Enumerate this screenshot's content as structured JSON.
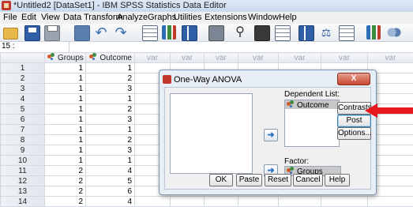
{
  "window": {
    "title": "*Untitled2 [DataSet1] - IBM SPSS Statistics Data Editor"
  },
  "menu": [
    "File",
    "Edit",
    "View",
    "Data",
    "Transform",
    "Analyze",
    "Graphs",
    "Utilities",
    "Extensions",
    "Window",
    "Help"
  ],
  "cell_ref": "15 :",
  "grid": {
    "headers": [
      "Groups",
      "Outcome",
      "var",
      "var",
      "var",
      "var",
      "var",
      "var",
      "var"
    ],
    "rows": [
      {
        "n": "1",
        "g": "1",
        "o": "1"
      },
      {
        "n": "2",
        "g": "1",
        "o": "2"
      },
      {
        "n": "3",
        "g": "1",
        "o": "3"
      },
      {
        "n": "4",
        "g": "1",
        "o": "1"
      },
      {
        "n": "5",
        "g": "1",
        "o": "2"
      },
      {
        "n": "6",
        "g": "1",
        "o": "3"
      },
      {
        "n": "7",
        "g": "1",
        "o": "1"
      },
      {
        "n": "8",
        "g": "1",
        "o": "2"
      },
      {
        "n": "9",
        "g": "1",
        "o": "3"
      },
      {
        "n": "10",
        "g": "1",
        "o": "1"
      },
      {
        "n": "11",
        "g": "2",
        "o": "4"
      },
      {
        "n": "12",
        "g": "2",
        "o": "5"
      },
      {
        "n": "13",
        "g": "2",
        "o": "6"
      },
      {
        "n": "14",
        "g": "2",
        "o": "4"
      }
    ]
  },
  "dialog": {
    "title": "One-Way ANOVA",
    "close": "X",
    "dependent_label": "Dependent List:",
    "dependent_items": [
      "Outcome"
    ],
    "factor_label": "Factor:",
    "factor_value": "Groups",
    "side_buttons": [
      "Contrasts...",
      "Post Hoc...",
      "Options..."
    ],
    "bottom_buttons": [
      "OK",
      "Paste",
      "Reset",
      "Cancel",
      "Help"
    ],
    "move_glyph": "➜"
  },
  "colors": {
    "annotation_arrow": "#e8191e"
  }
}
